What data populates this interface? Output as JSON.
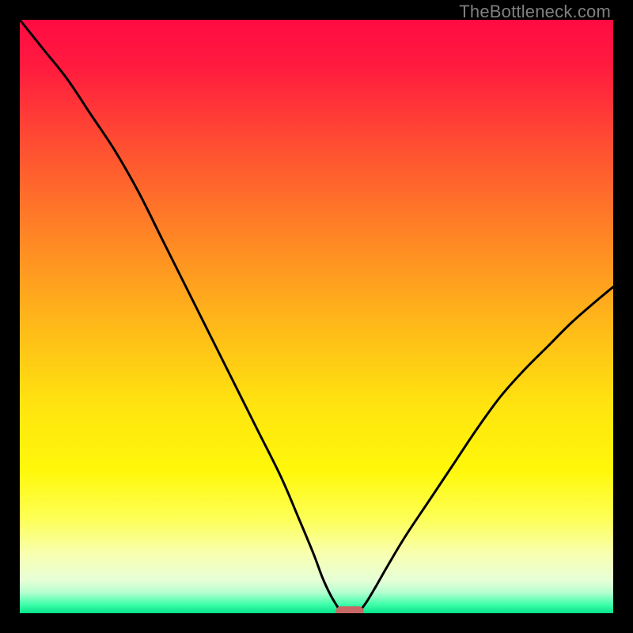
{
  "watermark": "TheBottleneck.com",
  "colors": {
    "frame": "#000000",
    "gradient_stops": [
      {
        "offset": 0.0,
        "color": "#ff0b43"
      },
      {
        "offset": 0.08,
        "color": "#ff1b3e"
      },
      {
        "offset": 0.2,
        "color": "#ff4a33"
      },
      {
        "offset": 0.35,
        "color": "#ff8026"
      },
      {
        "offset": 0.5,
        "color": "#ffb41a"
      },
      {
        "offset": 0.65,
        "color": "#ffe40f"
      },
      {
        "offset": 0.76,
        "color": "#fff80a"
      },
      {
        "offset": 0.84,
        "color": "#fdff55"
      },
      {
        "offset": 0.9,
        "color": "#f8ffb0"
      },
      {
        "offset": 0.945,
        "color": "#e6ffd7"
      },
      {
        "offset": 0.965,
        "color": "#b5ffcf"
      },
      {
        "offset": 0.985,
        "color": "#40ffab"
      },
      {
        "offset": 1.0,
        "color": "#06e38a"
      }
    ],
    "curve": "#000000",
    "marker_fill": "#c86864",
    "marker_stroke": "#c86864"
  },
  "chart_data": {
    "type": "line",
    "title": "",
    "xlabel": "",
    "ylabel": "",
    "xlim": [
      0,
      100
    ],
    "ylim": [
      0,
      100
    ],
    "series": [
      {
        "name": "left-branch",
        "x": [
          0,
          4,
          8,
          12,
          16,
          20,
          24,
          28,
          32,
          36,
          40,
          44,
          47,
          49.5,
          51,
          52.4,
          53.9
        ],
        "y": [
          100,
          95,
          90,
          84,
          78,
          71,
          63,
          55,
          47,
          39,
          31,
          23,
          16,
          10,
          6,
          3,
          0.5
        ]
      },
      {
        "name": "right-branch",
        "x": [
          57.4,
          58.5,
          60,
          62,
          65,
          69,
          73,
          77,
          81,
          85,
          89,
          93,
          97,
          100
        ],
        "y": [
          0.5,
          2,
          4.5,
          8,
          13,
          19,
          25,
          31,
          36.5,
          41,
          45,
          49,
          52.5,
          55
        ]
      }
    ],
    "marker": {
      "x_center": 55.6,
      "y": 0.3,
      "width": 4.6,
      "height": 1.6
    }
  }
}
